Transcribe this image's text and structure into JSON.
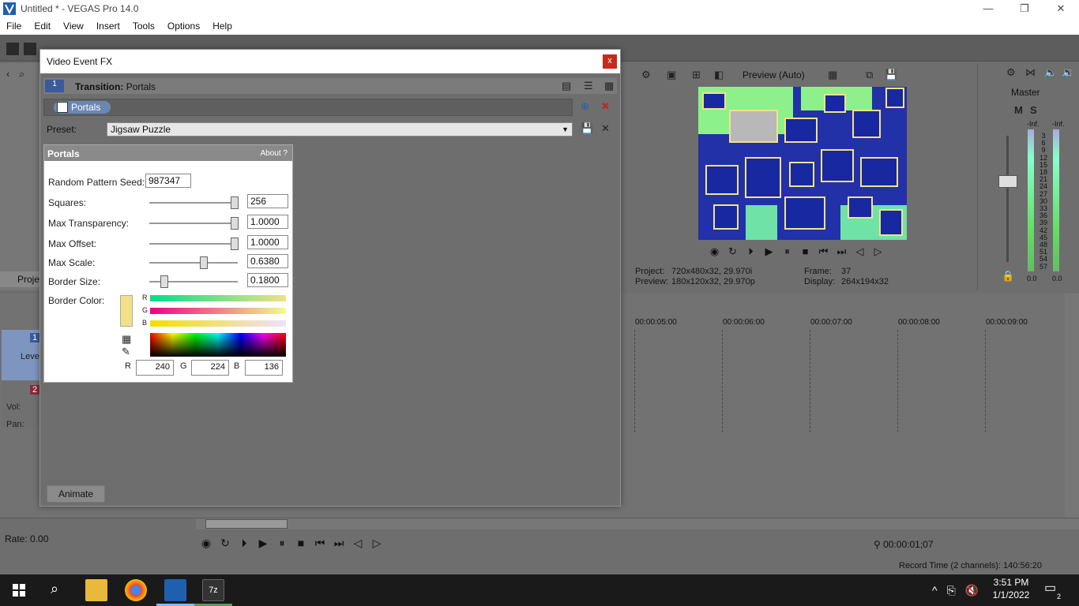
{
  "window": {
    "title": "Untitled * - VEGAS Pro 14.0",
    "min": "—",
    "restore": "❐",
    "close": "✕"
  },
  "menu": [
    "File",
    "Edit",
    "View",
    "Insert",
    "Tools",
    "Options",
    "Help"
  ],
  "preview": {
    "mode_label": "Preview (Auto)",
    "project_label": "Project:",
    "project_value": "720x480x32, 29.970i",
    "preview_label": "Preview:",
    "preview_value": "180x120x32, 29.970p",
    "frame_label": "Frame:",
    "frame_value": "37",
    "display_label": "Display:",
    "display_value": "264x194x32"
  },
  "master": {
    "label": "Master",
    "m": "M",
    "s": "S",
    "inf_left": "-Inf.",
    "inf_right": "-Inf.",
    "zero_left": "0.0",
    "zero_right": "0.0",
    "scale": [
      "3",
      "6",
      "9",
      "12",
      "15",
      "18",
      "21",
      "24",
      "27",
      "30",
      "33",
      "36",
      "39",
      "42",
      "45",
      "48",
      "51",
      "54",
      "57"
    ]
  },
  "explorer": {
    "tab_label": "Proje"
  },
  "timeline": {
    "ruler": [
      "00:00:05:00",
      "00:00:06:00",
      "00:00:07:00",
      "00:00:08:00",
      "00:00:09:00"
    ],
    "track1": {
      "number": "1",
      "label": "Leve"
    },
    "track2": {
      "number": "2",
      "vol": "Vol:",
      "pan": "Pan:"
    }
  },
  "bottom": {
    "rate": "Rate: 0.00",
    "timecode": "00:00:01;07",
    "record_time": "Record Time (2 channels): 140:56:20"
  },
  "taskbar": {
    "time": "3:51 PM",
    "date": "1/1/2022",
    "notif_count": "2"
  },
  "fx_dialog": {
    "title": "Video Event FX",
    "close": "x",
    "track_number": "1",
    "transition_prefix": "Transition:",
    "transition_name": "Portals",
    "chain_label": "Portals",
    "preset_label": "Preset:",
    "preset_value": "Jigsaw Puzzle",
    "animate_label": "Animate",
    "panel": {
      "name": "Portals",
      "about": "About  ?",
      "seed_label": "Random Pattern Seed:",
      "seed_value": "987347",
      "params": [
        {
          "label": "Squares:",
          "value": "256",
          "level": 1.0
        },
        {
          "label": "Max Transparency:",
          "value": "1.0000",
          "level": 1.0
        },
        {
          "label": "Max Offset:",
          "value": "1.0000",
          "level": 1.0
        },
        {
          "label": "Max Scale:",
          "value": "0.6380",
          "level": 0.638
        },
        {
          "label": "Border Size:",
          "value": "0.1800",
          "level": 0.18
        }
      ],
      "border_color_label": "Border Color:",
      "swatch_color": "#f0e088",
      "r_label": "R",
      "g_label": "G",
      "b_label": "B",
      "r_value": "240",
      "g_value": "224",
      "b_value": "136"
    }
  }
}
